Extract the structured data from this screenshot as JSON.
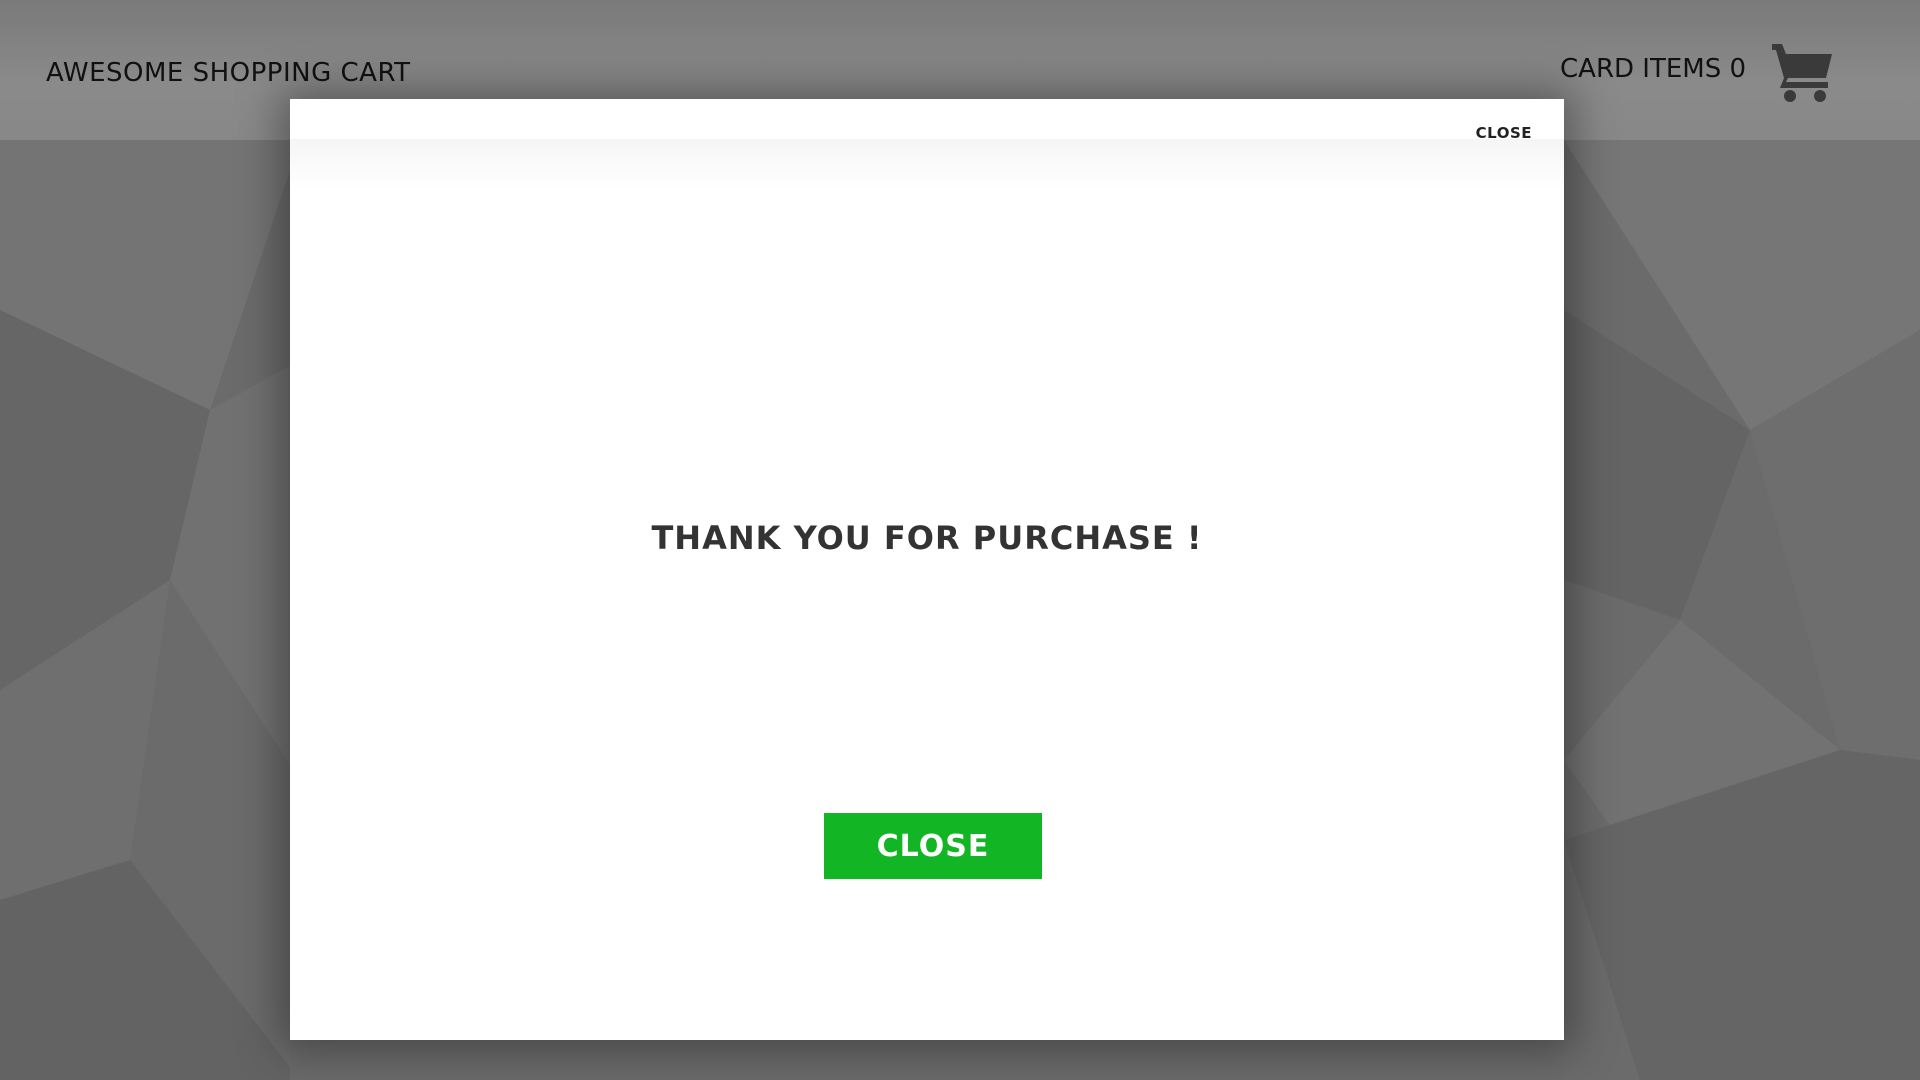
{
  "header": {
    "title": "AWESOME SHOPPING CART",
    "cart_label": "CARD ITEMS",
    "cart_count": "0",
    "cart_icon": "shopping-cart-icon"
  },
  "modal": {
    "close_link_label": "CLOSE",
    "message": "THANK YOU FOR PURCHASE !",
    "close_button_label": "CLOSE"
  },
  "colors": {
    "accent_green": "#12b523",
    "header_bg": "#888888",
    "background": "#6d6d6d",
    "cart_icon": "#3a3a3a"
  }
}
